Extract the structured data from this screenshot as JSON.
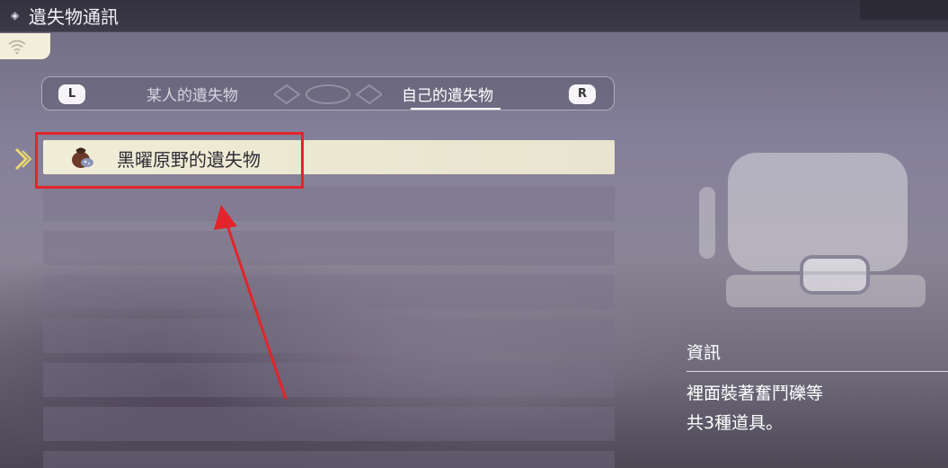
{
  "header": {
    "title": "遺失物通訊",
    "title_icon": "diamond-icon",
    "status_icon": "wifi-icon"
  },
  "tabs": {
    "left_button": "L",
    "right_button": "R",
    "items": [
      {
        "label": "某人的遺失物",
        "selected": false
      },
      {
        "label": "自己的遺失物",
        "selected": true
      }
    ]
  },
  "list": {
    "items": [
      {
        "label": "黑曜原野的遺失物",
        "icon": "satchel-icon",
        "selected": true
      }
    ],
    "empty_rows": 7
  },
  "info": {
    "heading": "資訊",
    "lines": [
      "裡面裝著奮鬥礫等",
      "共3種道具。"
    ]
  },
  "annotation": {
    "color": "#e3242b"
  },
  "colors": {
    "selected_row": "#f0edd6",
    "accent_yellow": "#e9d770",
    "titlebar": "#34323f"
  }
}
